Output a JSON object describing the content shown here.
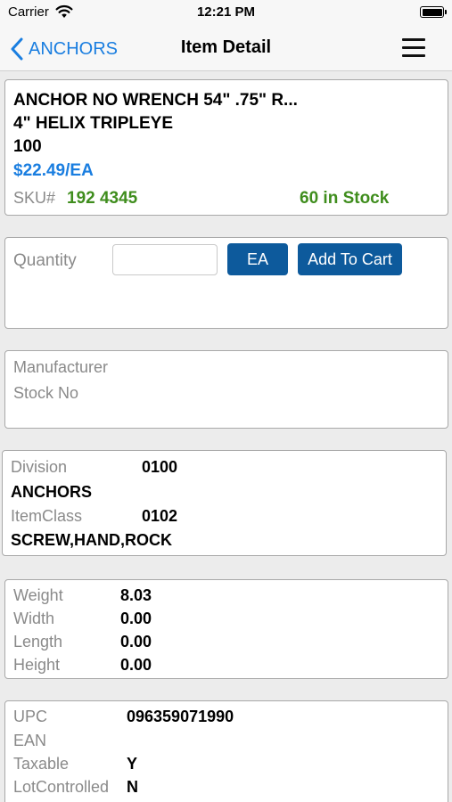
{
  "status_bar": {
    "carrier": "Carrier",
    "time": "12:21 PM"
  },
  "nav": {
    "back_label": "ANCHORS",
    "title": "Item Detail"
  },
  "item": {
    "title_line1": "ANCHOR NO WRENCH 54\" .75\" R...",
    "title_line2": "4\" HELIX TRIPLEYE",
    "title_line3": "100",
    "price": "$22.49/EA",
    "sku_label": "SKU#",
    "sku_value": "192 4345",
    "stock": "60 in Stock"
  },
  "order": {
    "quantity_label": "Quantity",
    "quantity_value": "",
    "unit_button": "EA",
    "add_to_cart_button": "Add To Cart"
  },
  "manufacturer": {
    "manufacturer_label": "Manufacturer",
    "stock_no_label": "Stock No"
  },
  "classification": {
    "division_label": "Division",
    "division_value": "0100",
    "division_name": "ANCHORS",
    "itemclass_label": "ItemClass",
    "itemclass_value": "0102",
    "itemclass_name": "SCREW,HAND,ROCK"
  },
  "dimensions": {
    "weight_label": "Weight",
    "weight_value": "8.03",
    "width_label": "Width",
    "width_value": "0.00",
    "length_label": "Length",
    "length_value": "0.00",
    "height_label": "Height",
    "height_value": "0.00"
  },
  "codes": {
    "upc_label": "UPC",
    "upc_value": "096359071990",
    "ean_label": "EAN",
    "taxable_label": "Taxable",
    "taxable_value": "Y",
    "lot_label": "LotControlled",
    "lot_value": "N"
  },
  "colors": {
    "accent": "#1a7ee0",
    "stock_green": "#3f8d1d",
    "button": "#0d5a9c"
  }
}
